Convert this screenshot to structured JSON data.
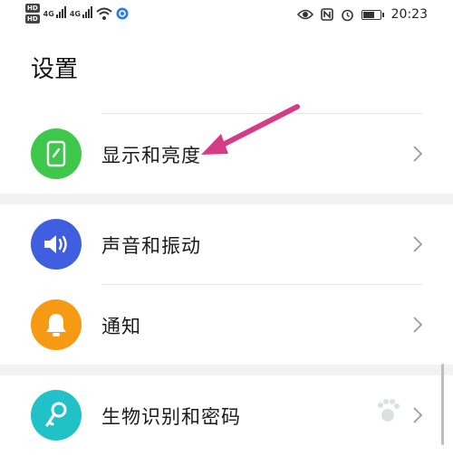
{
  "status_bar": {
    "hd1": "HD",
    "hd2": "HD",
    "net1": "4G",
    "net2": "4G",
    "time": "20:23",
    "battery_level": 0.8
  },
  "page": {
    "title": "设置"
  },
  "settings": {
    "display": {
      "label": "显示和亮度",
      "color": "#3ec84b",
      "icon": "phone-brightness-icon"
    },
    "sound": {
      "label": "声音和振动",
      "color": "#3f5fe0",
      "icon": "speaker-icon"
    },
    "notifications": {
      "label": "通知",
      "color": "#f59a12",
      "icon": "bell-icon"
    },
    "biometrics": {
      "label": "生物识别和密码",
      "color": "#21c1c8",
      "icon": "key-icon"
    }
  },
  "annotation": {
    "color": "#d43c86"
  }
}
